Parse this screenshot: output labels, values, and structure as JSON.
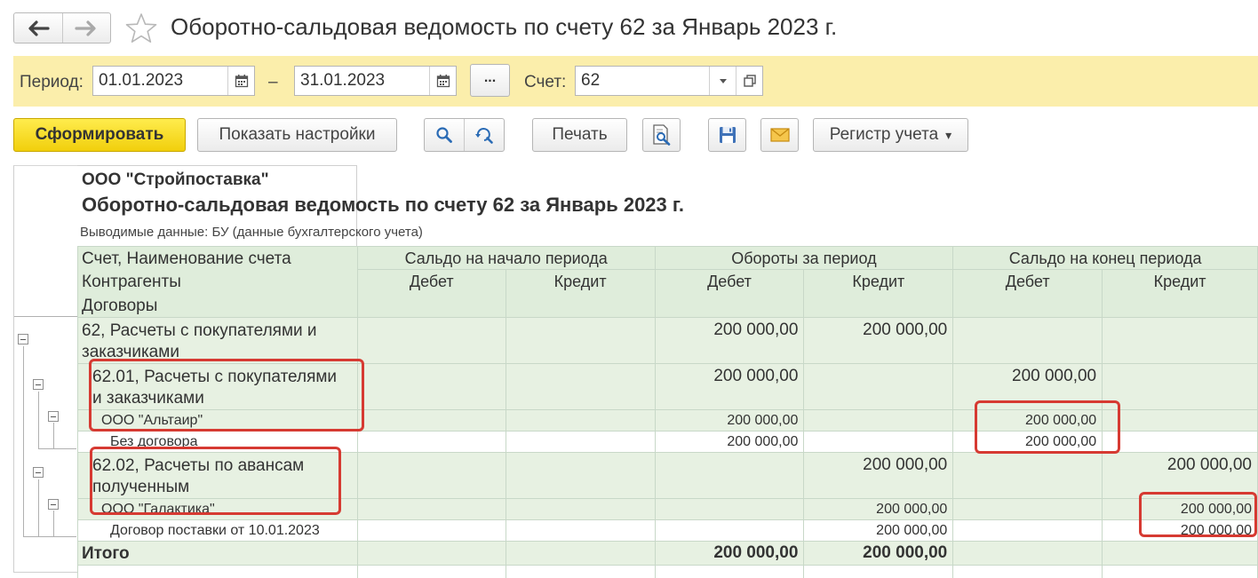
{
  "window": {
    "title": "Оборотно-сальдовая ведомость по счету 62 за Январь 2023 г."
  },
  "icons": {
    "back": "arrow-left-icon",
    "forward": "arrow-right-icon",
    "favorite": "star-icon",
    "calendar": "calendar-icon",
    "dropdown": "chevron-down-icon",
    "open": "open-window-icon",
    "search": "search-icon",
    "refresh_search": "search-refresh-icon",
    "preview": "print-preview-icon",
    "save": "floppy-disk-icon",
    "mail": "envelope-icon"
  },
  "filters": {
    "period_label": "Период:",
    "date_from": "01.01.2023",
    "dash": "–",
    "date_to": "31.01.2023",
    "more_label": "...",
    "account_label": "Счет:",
    "account_value": "62"
  },
  "toolbar": {
    "generate_label": "Сформировать",
    "settings_label": "Показать настройки",
    "print_label": "Печать",
    "register_label": "Регистр учета",
    "register_arrow": "▾"
  },
  "report": {
    "company": "ООО \"Стройпоставка\"",
    "title": "Оборотно-сальдовая ведомость по счету 62 за Январь 2023 г.",
    "note": "Выводимые данные:  БУ (данные бухгалтерского учета)",
    "headers": {
      "row_titles": [
        "Счет, Наименование счета",
        "Контрагенты",
        "Договоры"
      ],
      "groups": [
        "Сальдо на начало периода",
        "Обороты за период",
        "Сальдо на конец периода"
      ],
      "debit": "Дебет",
      "credit": "Кредит"
    },
    "rows": [
      {
        "name": "62, Расчеты с покупателями и заказчиками",
        "start_debit": "",
        "start_credit": "",
        "turn_debit": "200 000,00",
        "turn_credit": "200 000,00",
        "end_debit": "",
        "end_credit": ""
      },
      {
        "name": "62.01, Расчеты с покупателями и заказчиками",
        "start_debit": "",
        "start_credit": "",
        "turn_debit": "200 000,00",
        "turn_credit": "",
        "end_debit": "200 000,00",
        "end_credit": ""
      },
      {
        "name": "ООО \"Альтаир\"",
        "start_debit": "",
        "start_credit": "",
        "turn_debit": "200 000,00",
        "turn_credit": "",
        "end_debit": "200 000,00",
        "end_credit": ""
      },
      {
        "name": "Без договора",
        "start_debit": "",
        "start_credit": "",
        "turn_debit": "200 000,00",
        "turn_credit": "",
        "end_debit": "200 000,00",
        "end_credit": ""
      },
      {
        "name": "62.02, Расчеты по авансам полученным",
        "start_debit": "",
        "start_credit": "",
        "turn_debit": "",
        "turn_credit": "200 000,00",
        "end_debit": "",
        "end_credit": "200 000,00"
      },
      {
        "name": "ООО \"Галактика\"",
        "start_debit": "",
        "start_credit": "",
        "turn_debit": "",
        "turn_credit": "200 000,00",
        "end_debit": "",
        "end_credit": "200 000,00"
      },
      {
        "name": "Договор поставки от 10.01.2023",
        "start_debit": "",
        "start_credit": "",
        "turn_debit": "",
        "turn_credit": "200 000,00",
        "end_debit": "",
        "end_credit": "200 000,00"
      }
    ],
    "total": {
      "name": "Итого",
      "start_debit": "",
      "start_credit": "",
      "turn_debit": "200 000,00",
      "turn_credit": "200 000,00",
      "end_debit": "",
      "end_credit": ""
    }
  },
  "colors": {
    "filter_bar": "#fbeeab",
    "primary_button": "#f5d713",
    "header_cells": "#dfeddb",
    "group_rows": "#e7f1e2",
    "highlight": "#d63a32"
  }
}
